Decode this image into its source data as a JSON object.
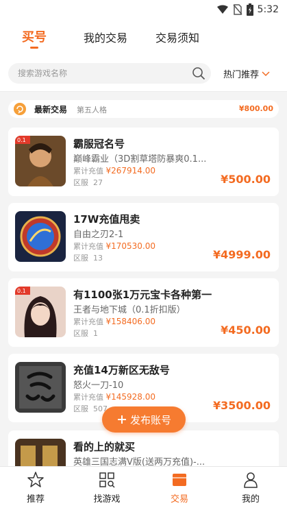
{
  "statusbar": {
    "time": "5:32"
  },
  "topnav": {
    "tabs": [
      {
        "label": "买号",
        "active": true
      },
      {
        "label": "我的交易",
        "active": false
      },
      {
        "label": "交易须知",
        "active": false
      }
    ]
  },
  "search": {
    "placeholder": "搜索游戏名称",
    "sort_label": "热门推荐"
  },
  "latest": {
    "title": "最新交易",
    "name": "第五人格",
    "price": "¥800.00"
  },
  "listings": [
    {
      "title": "霸服冠名号",
      "game": "巅峰霸业（3D割草塔防暴爽0.1...",
      "charge_label": "累计充值",
      "charge": "¥267914.00",
      "server_label": "区服",
      "server": "27",
      "price": "¥500.00"
    },
    {
      "title": "17W充值甩卖",
      "game": "自由之刃2-1",
      "charge_label": "累计充值",
      "charge": "¥170530.00",
      "server_label": "区服",
      "server": "13",
      "price": "¥4999.00"
    },
    {
      "title": "有1100张1万元宝卡各种第一",
      "game": "王者与地下城（0.1折扣版）",
      "charge_label": "累计充值",
      "charge": "¥158406.00",
      "server_label": "区服",
      "server": "1",
      "price": "¥450.00"
    },
    {
      "title": "充值14万新区无敌号",
      "game": "怒火一刀-10",
      "charge_label": "累计充值",
      "charge": "¥145928.00",
      "server_label": "区服",
      "server": "507",
      "price": "¥3500.00"
    },
    {
      "title": "看的上的就买",
      "game": "英雄三国志满V版(送两万充值)-...",
      "charge_label": "",
      "charge": "",
      "server_label": "",
      "server": "",
      "price": ""
    }
  ],
  "publish_button": {
    "label": "发布账号"
  },
  "bottom_tabs": [
    {
      "label": "推荐",
      "icon": "star-icon",
      "active": false
    },
    {
      "label": "找游戏",
      "icon": "grid-search-icon",
      "active": false
    },
    {
      "label": "交易",
      "icon": "trade-box-icon",
      "active": true
    },
    {
      "label": "我的",
      "icon": "person-icon",
      "active": false
    }
  ],
  "colors": {
    "accent": "#f36b21",
    "background": "#f4f4f4"
  }
}
